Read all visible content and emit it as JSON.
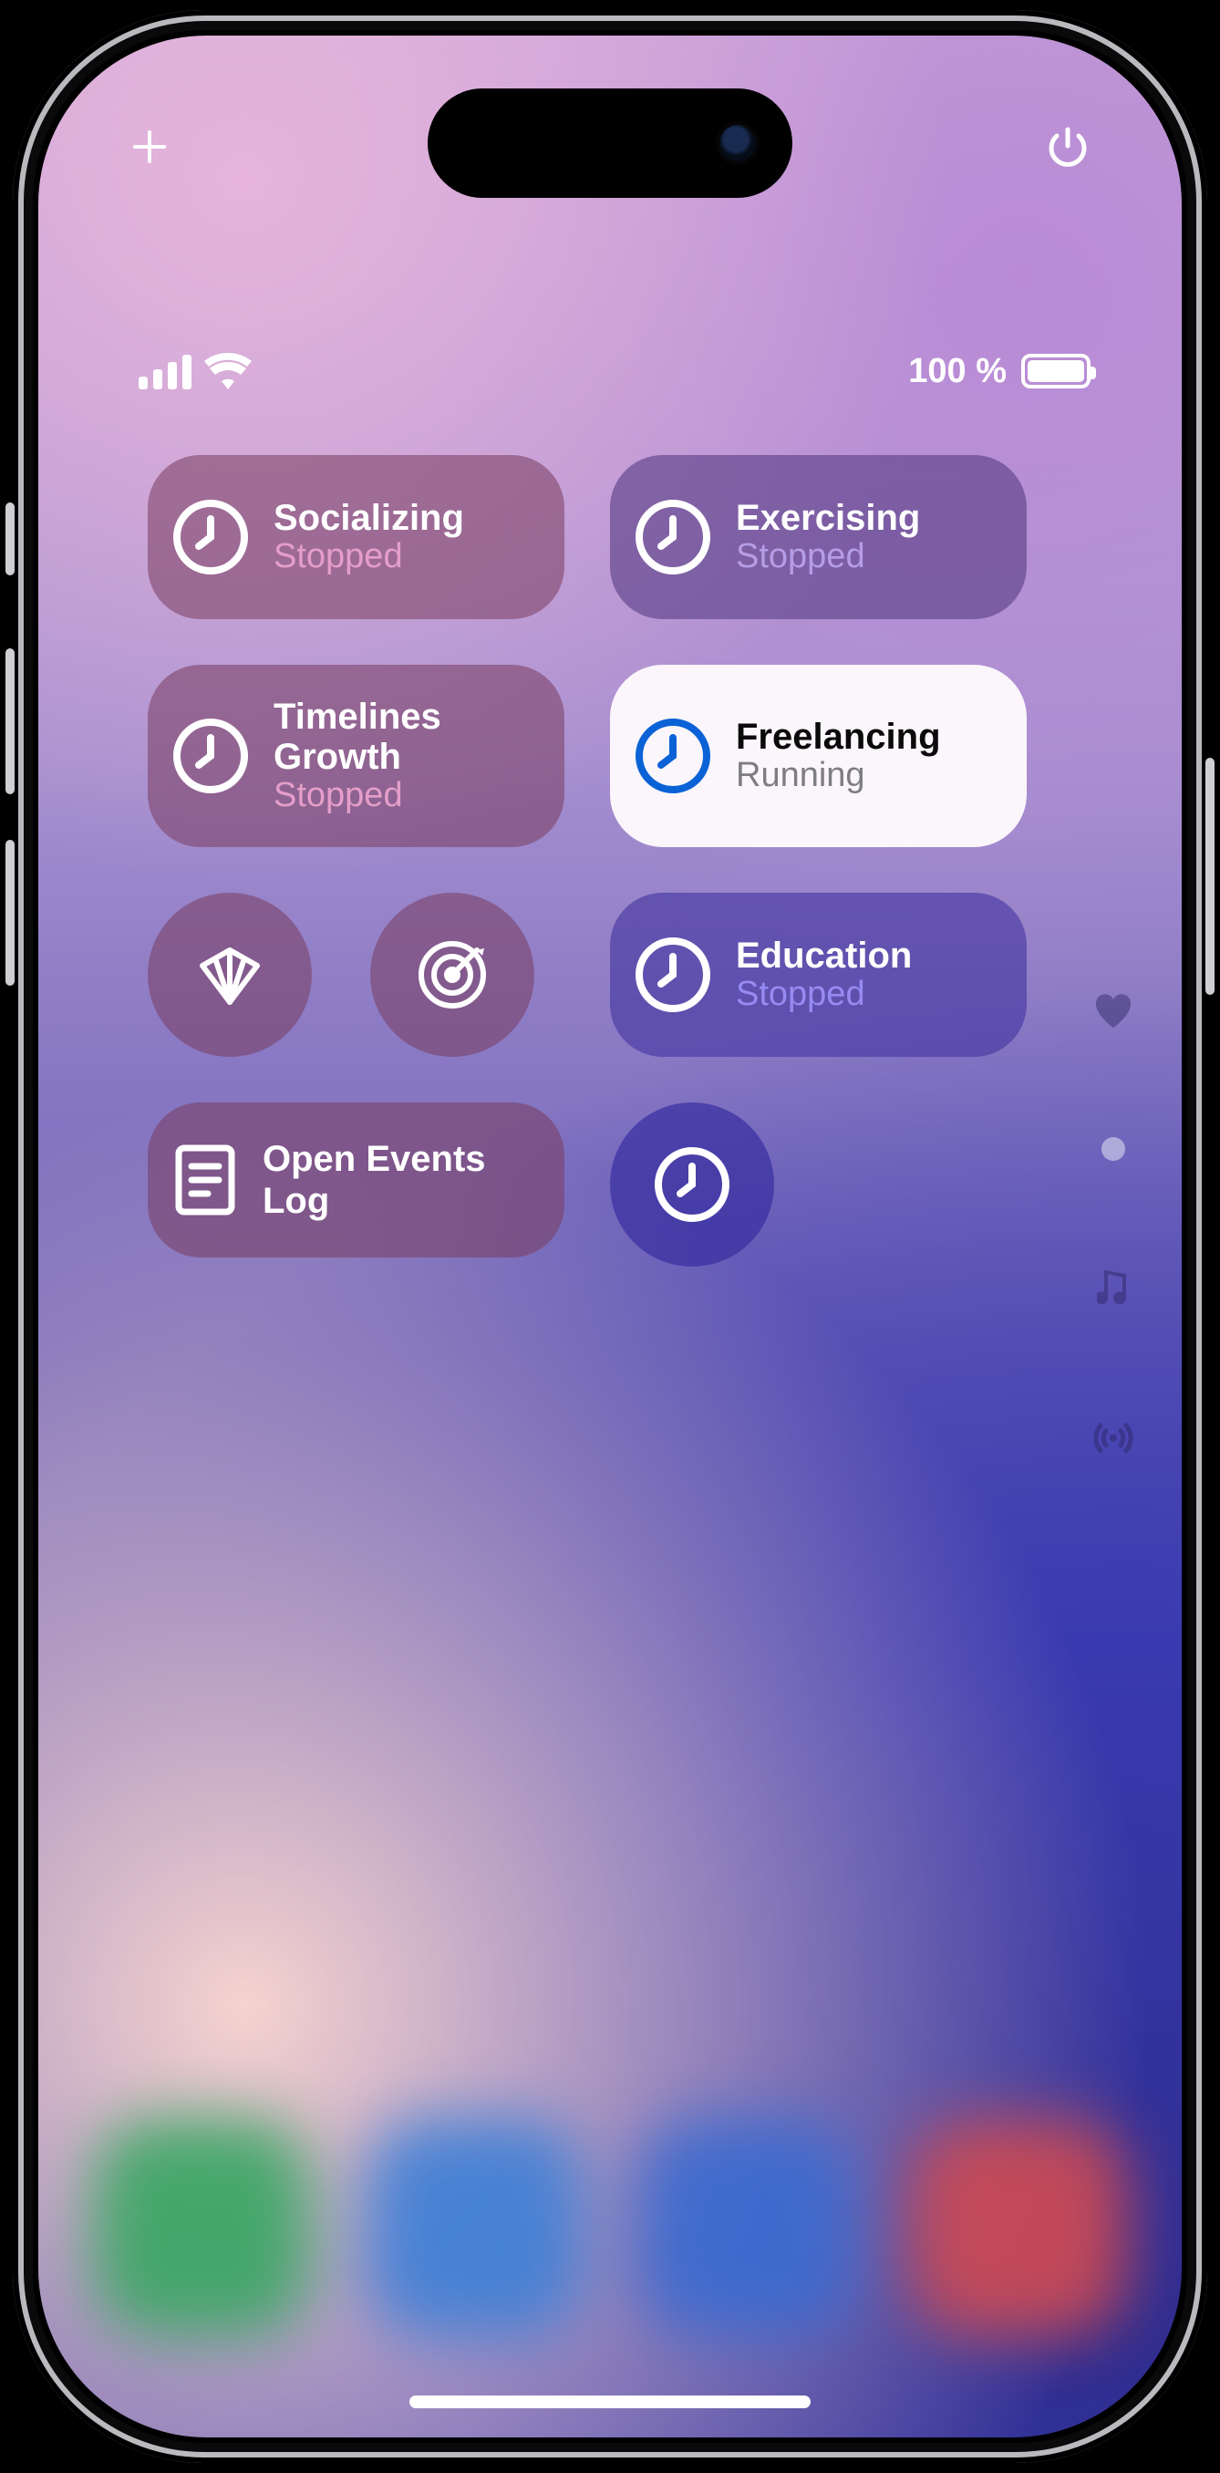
{
  "status": {
    "battery_text": "100 %"
  },
  "tiles": {
    "socializing": {
      "title": "Socializing",
      "status": "Stopped"
    },
    "exercising": {
      "title": "Exercising",
      "status": "Stopped"
    },
    "timelines": {
      "title": "Timelines Growth",
      "status": "Stopped"
    },
    "freelancing": {
      "title": "Freelancing",
      "status": "Running"
    },
    "education": {
      "title": "Education",
      "status": "Stopped"
    },
    "events_log": {
      "title": "Open Events Log"
    }
  }
}
